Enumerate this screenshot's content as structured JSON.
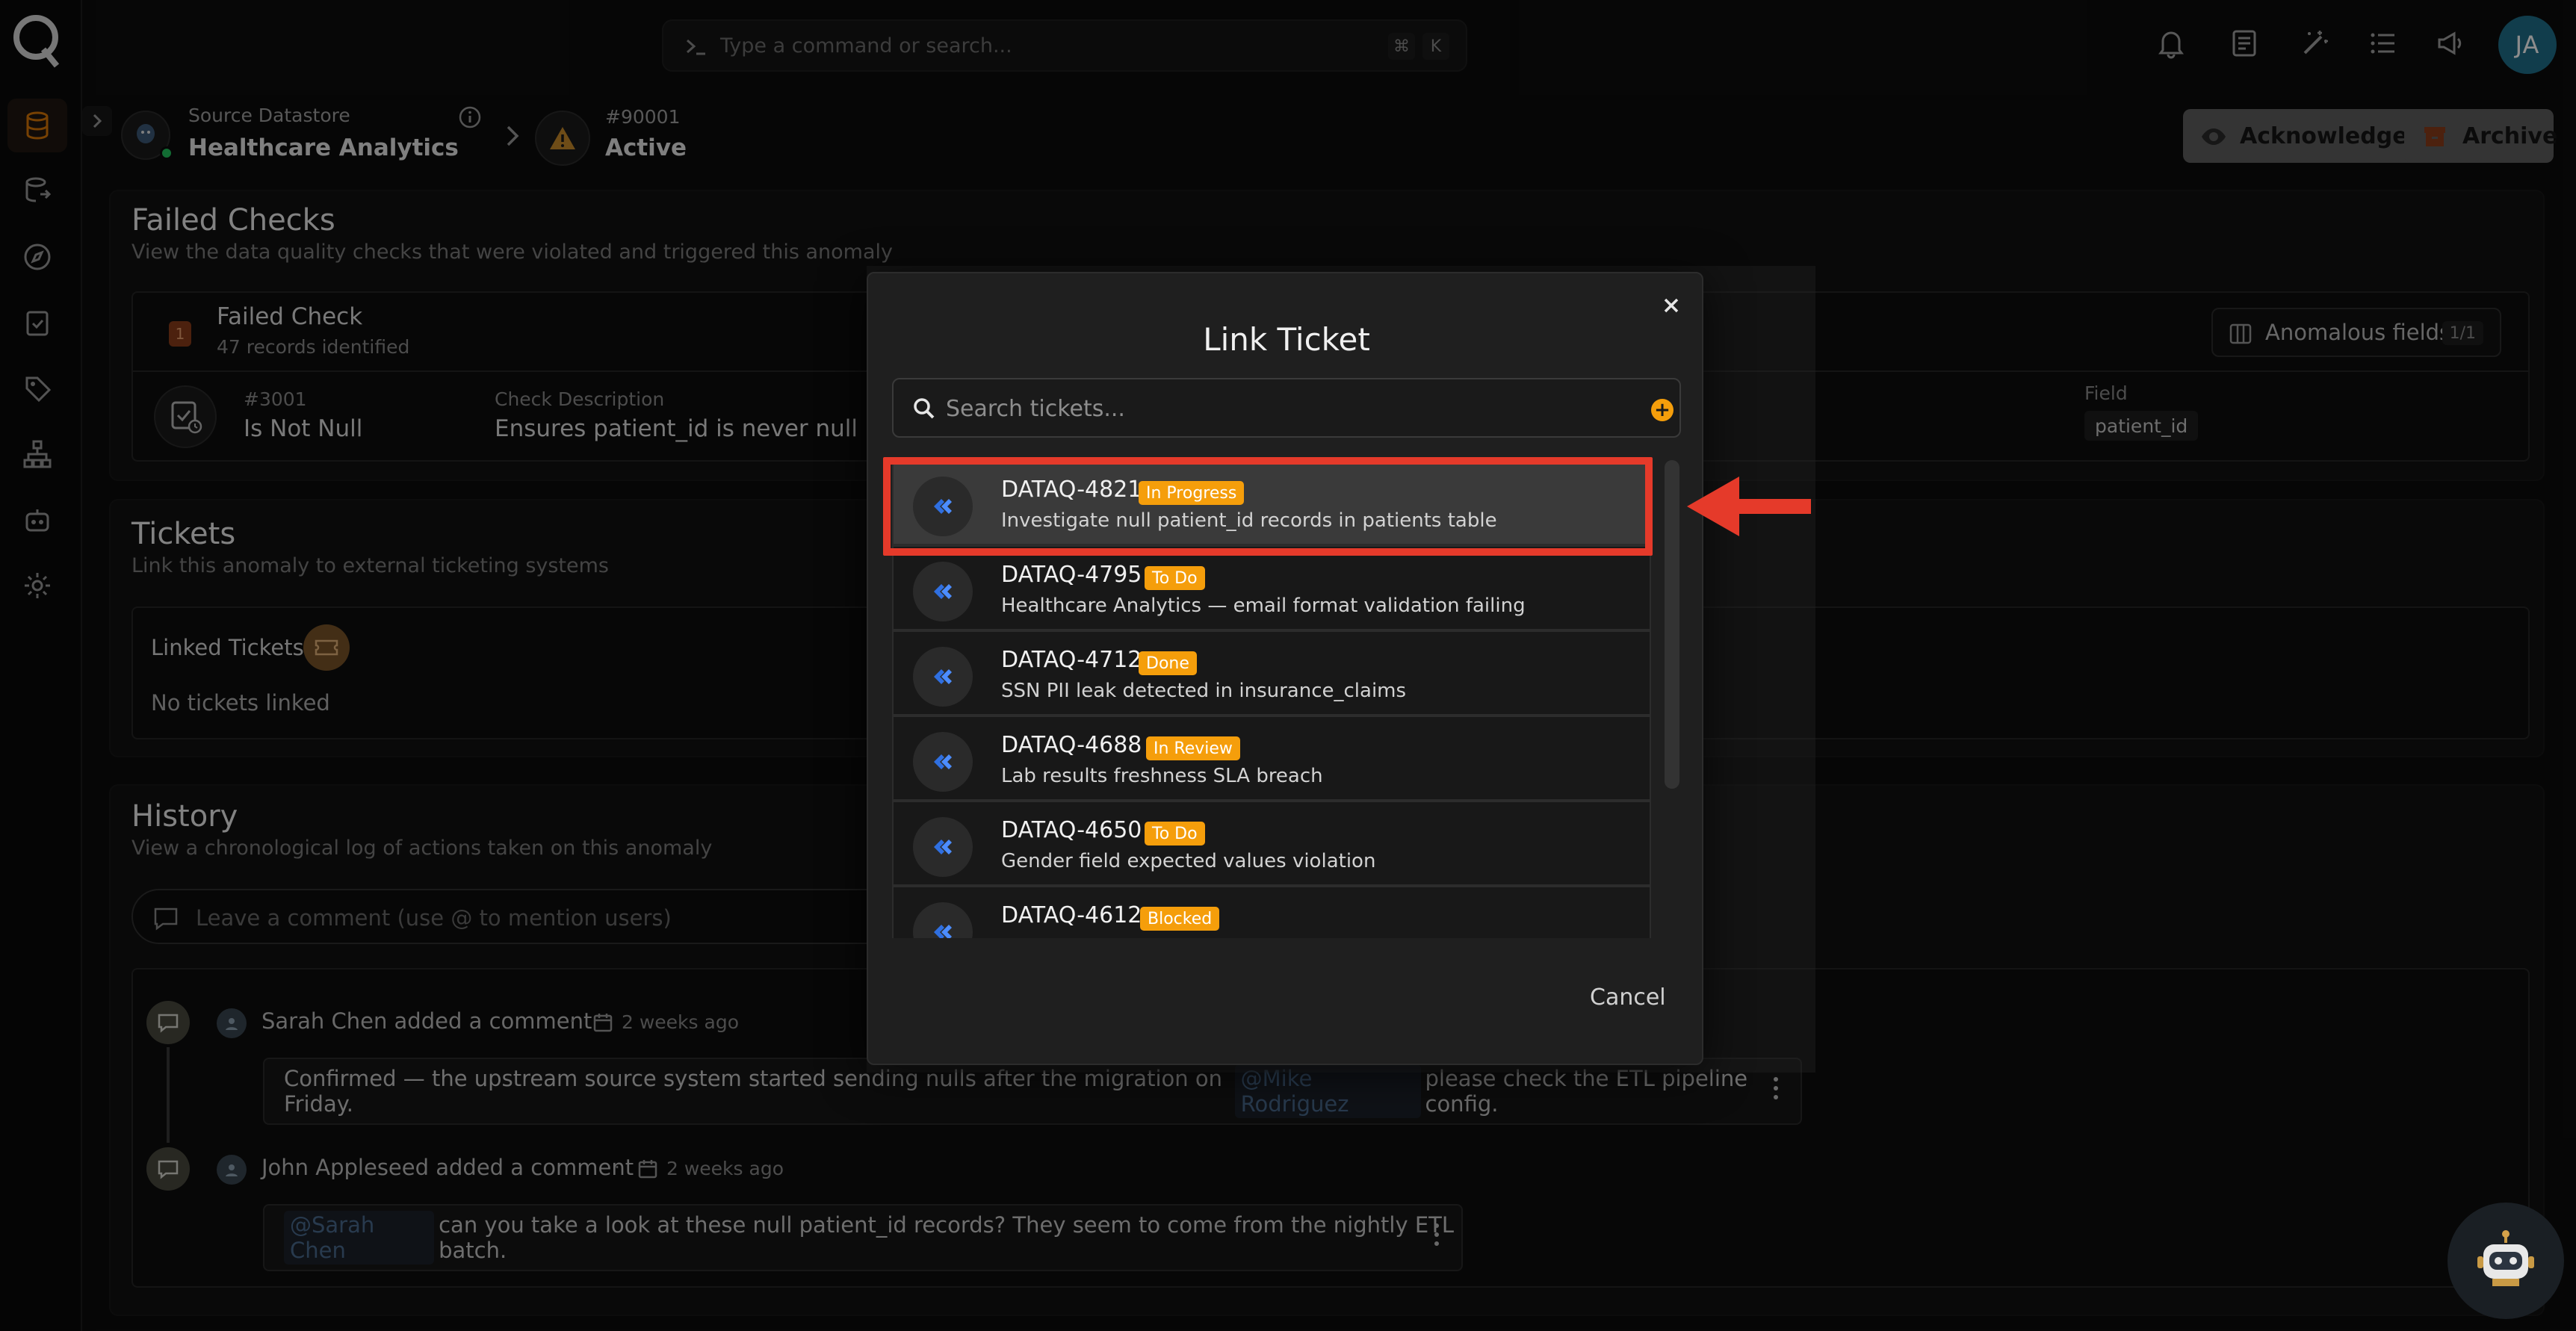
{
  "command_bar": {
    "placeholder": "Type a command or search...",
    "key1": "⌘",
    "key2": "K"
  },
  "user": {
    "initials": "JA"
  },
  "header": {
    "datastore_sub": "Source Datastore",
    "datastore_title": "Healthcare Analytics",
    "anomaly_id": "#90001",
    "anomaly_status": "Active",
    "acknowledge_label": "Acknowledge",
    "archive_label": "Archive"
  },
  "failed_checks": {
    "title": "Failed Checks",
    "subtitle": "View the data quality checks that were violated and triggered this anomaly",
    "badge": "1",
    "card_title": "Failed Check",
    "records": "47 records identified",
    "anomalous_fields_label": "Anomalous fields",
    "anomalous_fields_count": "1/1",
    "check_id": "#3001",
    "check_name": "Is Not Null",
    "desc_label": "Check Description",
    "desc_value": "Ensures patient_id is never null",
    "field_label": "Field",
    "field_value": "patient_id"
  },
  "tickets": {
    "title": "Tickets",
    "subtitle": "Link this anomaly to external ticketing systems",
    "linked_label": "Linked Tickets",
    "empty": "No tickets linked"
  },
  "history": {
    "title": "History",
    "subtitle": "View a chronological log of actions taken on this anomaly",
    "comment_placeholder": "Leave a comment (use @ to mention users)",
    "entries": [
      {
        "author_line": "Sarah Chen added a comment",
        "time": "2 weeks ago",
        "pre": "Confirmed — the upstream source system started sending nulls after the migration on Friday.",
        "mention": "@Mike Rodriguez",
        "post": "please check the ETL pipeline config."
      },
      {
        "author_line": "John Appleseed added a comment",
        "time": "2 weeks ago",
        "mention": "@Sarah Chen",
        "post": "can you take a look at these null patient_id records? They seem to come from the nightly ETL batch."
      }
    ]
  },
  "modal": {
    "title": "Link Ticket",
    "search_placeholder": "Search tickets...",
    "cancel_label": "Cancel",
    "tickets": [
      {
        "key": "DATAQ-4821",
        "status": "In Progress",
        "desc": "Investigate null patient_id records in patients table"
      },
      {
        "key": "DATAQ-4795",
        "status": "To Do",
        "desc": "Healthcare Analytics — email format validation failing"
      },
      {
        "key": "DATAQ-4712",
        "status": "Done",
        "desc": "SSN PII leak detected in insurance_claims"
      },
      {
        "key": "DATAQ-4688",
        "status": "In Review",
        "desc": "Lab results freshness SLA breach"
      },
      {
        "key": "DATAQ-4650",
        "status": "To Do",
        "desc": "Gender field expected values violation"
      },
      {
        "key": "DATAQ-4612",
        "status": "Blocked",
        "desc": ""
      }
    ]
  },
  "colors": {
    "accent": "#f59e0b",
    "highlight": "#e53a2a",
    "rail_active": "#d97706"
  }
}
